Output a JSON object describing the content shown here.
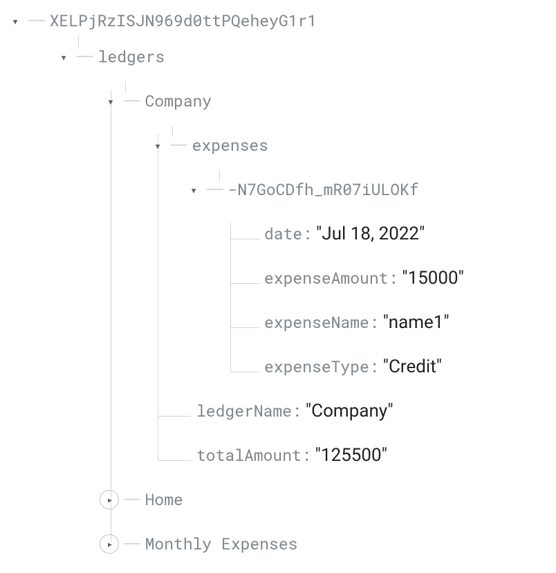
{
  "root": {
    "key": "XELPjRzISJN969d0ttPQeheyG1r1"
  },
  "ledgers": {
    "key": "ledgers"
  },
  "company": {
    "key": "Company",
    "ledgerName": {
      "label": "ledgerName",
      "value": "\"Company\""
    },
    "totalAmount": {
      "label": "totalAmount",
      "value": "\"125500\""
    }
  },
  "expenses": {
    "key": "expenses"
  },
  "expenseRecord": {
    "key": "-N7GoCDfh_mR07iULOKf",
    "date": {
      "label": "date",
      "value": "\"Jul 18, 2022\""
    },
    "expenseAmount": {
      "label": "expenseAmount",
      "value": "\"15000\""
    },
    "expenseName": {
      "label": "expenseName",
      "value": "\"name1\""
    },
    "expenseType": {
      "label": "expenseType",
      "value": "\"Credit\""
    }
  },
  "home": {
    "key": "Home"
  },
  "monthly": {
    "key": "Monthly Expenses"
  }
}
